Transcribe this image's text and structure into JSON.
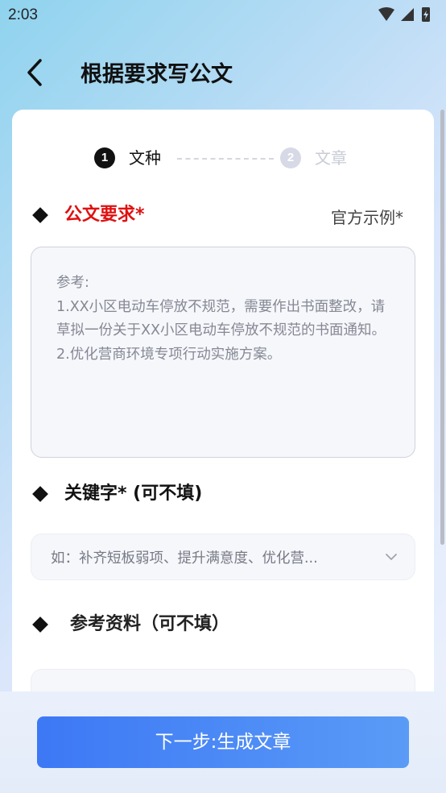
{
  "status_bar": {
    "time": "2:03"
  },
  "header": {
    "title": "根据要求写公文"
  },
  "steps": [
    {
      "number": "1",
      "label": "文种"
    },
    {
      "number": "2",
      "label": "文章"
    }
  ],
  "requirements": {
    "label": "公文要求*",
    "example_link": "官方示例*",
    "placeholder": "参考:\n1.XX小区电动车停放不规范，需要作出书面整改，请草拟一份关于XX小区电动车停放不规范的书面通知。\n2.优化营商环境专项行动实施方案。"
  },
  "keywords": {
    "label": "关键字* (可不填)",
    "placeholder": "如：补齐短板弱项、提升满意度、优化营..."
  },
  "references": {
    "label": "参考资料（可不填）"
  },
  "footer": {
    "next_button": "下一步:生成文章"
  },
  "colors": {
    "required_red": "#e01010",
    "button_blue": "#3d78f5",
    "step_inactive": "#d7d9e6"
  },
  "icons": [
    "wifi-icon",
    "signal-icon",
    "battery-icon",
    "back-arrow-icon",
    "chevron-down-icon",
    "diamond-bullet-icon"
  ]
}
